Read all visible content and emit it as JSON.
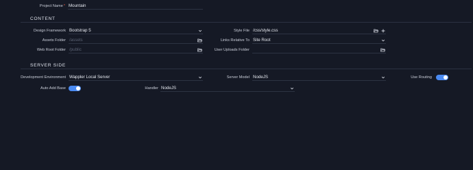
{
  "project": {
    "name_label": "Project Name",
    "required_mark": "*",
    "name_value": "Mountain"
  },
  "content": {
    "title": "CONTENT",
    "design_framework": {
      "label": "Design Framework",
      "value": "Bootstrap 5"
    },
    "assets_folder": {
      "label": "Assets Folder",
      "placeholder": "/assets"
    },
    "web_root_folder": {
      "label": "Web Root Folder",
      "placeholder": "/public"
    },
    "style_file": {
      "label": "Style File",
      "value": "/css/style.css"
    },
    "links_relative_to": {
      "label": "Links Relative To",
      "value": "Site Root"
    },
    "user_uploads_folder": {
      "label": "User Uploads Folder",
      "value": ""
    }
  },
  "server_side": {
    "title": "SERVER SIDE",
    "development_environment": {
      "label": "Development Environment",
      "value": "Wappler Local Server"
    },
    "server_model": {
      "label": "Server Model",
      "value": "NodeJS"
    },
    "use_routing": {
      "label": "Use Routing",
      "on": true
    },
    "auto_add_base": {
      "label": "Auto Add Base",
      "on": true
    },
    "handler": {
      "label": "Handler",
      "value": "NodeJS"
    }
  },
  "icons": {
    "chevron": "chevron-down-icon",
    "folder": "folder-open-icon",
    "plus": "plus-icon"
  },
  "colors": {
    "background": "#151925",
    "accent": "#4a8af2",
    "divider": "#2c3242",
    "placeholder": "#5b6273"
  }
}
